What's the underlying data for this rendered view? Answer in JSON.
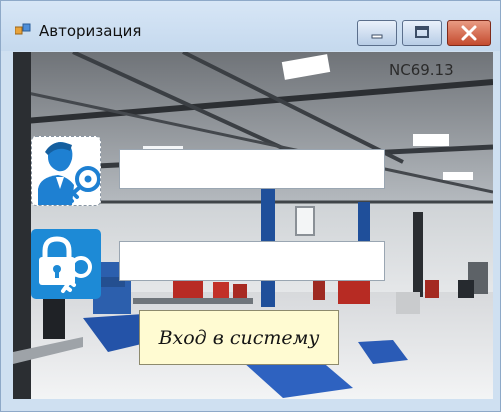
{
  "window": {
    "title": "Авторизация"
  },
  "form": {
    "version": "NC69.13",
    "login_value": "",
    "password_value": "",
    "user_icon": "user-key-icon",
    "password_icon": "lock-key-icon",
    "login_button_label": "Вход в систему"
  },
  "colors": {
    "button_background": "#fffbd2",
    "password_icon_background": "#1d8ad6",
    "close_button": "#c44b2f"
  }
}
